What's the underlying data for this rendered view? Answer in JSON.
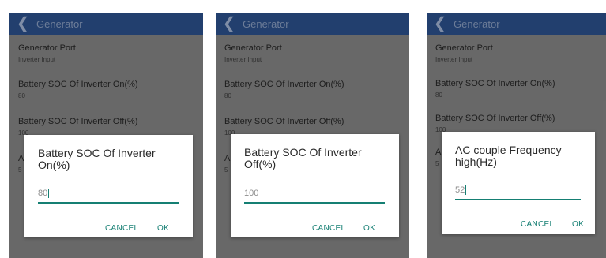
{
  "screens": [
    {
      "header": {
        "back_icon": "chevron-left-icon",
        "title": "Generator"
      },
      "rows": [
        {
          "label": "Generator Port",
          "value": "Inverter Input"
        },
        {
          "label": "Battery SOC Of Inverter On(%)",
          "value": "80"
        },
        {
          "label": "Battery SOC Of Inverter Off(%)",
          "value": "100"
        },
        {
          "label_partial": "A",
          "value_partial": "5"
        }
      ],
      "dialog": {
        "title": "Battery SOC Of Inverter On(%)",
        "input_value": "80",
        "cancel_label": "CANCEL",
        "ok_label": "OK"
      }
    },
    {
      "header": {
        "back_icon": "chevron-left-icon",
        "title": "Generator"
      },
      "rows": [
        {
          "label": "Generator Port",
          "value": "Inverter Input"
        },
        {
          "label": "Battery SOC Of Inverter On(%)",
          "value": "80"
        },
        {
          "label": "Battery SOC Of Inverter Off(%)",
          "value": "100"
        },
        {
          "label_partial": "A",
          "value_partial": "5"
        }
      ],
      "dialog": {
        "title": "Battery SOC Of Inverter Off(%)",
        "input_value": "100",
        "cancel_label": "CANCEL",
        "ok_label": "OK"
      }
    },
    {
      "header": {
        "back_icon": "chevron-left-icon",
        "title": "Generator"
      },
      "rows": [
        {
          "label": "Generator Port",
          "value": "Inverter Input"
        },
        {
          "label": "Battery SOC Of Inverter On(%)",
          "value": "80"
        },
        {
          "label": "Battery SOC Of Inverter Off(%)",
          "value": "100"
        },
        {
          "label_partial": "A",
          "value_partial": "5"
        }
      ],
      "dialog": {
        "title": "AC couple Frequency high(Hz)",
        "input_value": "52",
        "cancel_label": "CANCEL",
        "ok_label": "OK"
      }
    }
  ],
  "colors": {
    "appbar": "#223f6e",
    "screen_dimmed": "#6b6b6b",
    "accent": "#157f73"
  }
}
